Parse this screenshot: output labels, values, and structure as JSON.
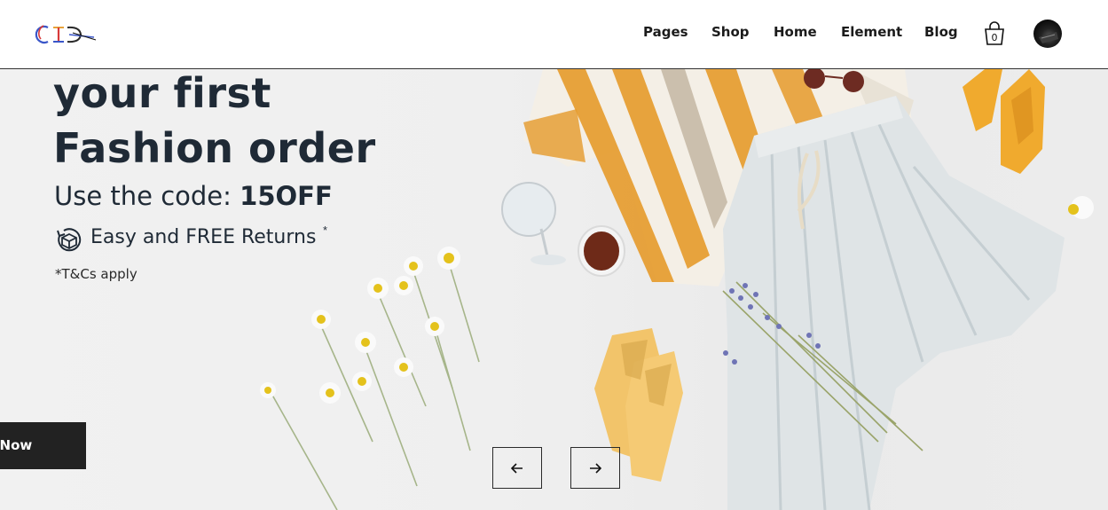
{
  "header": {
    "logo_text": "CIG",
    "nav": [
      {
        "label": "Pages"
      },
      {
        "label": "Shop"
      },
      {
        "label": "Home"
      },
      {
        "label": "Element"
      },
      {
        "label": "Blog"
      }
    ],
    "cart_count": "0",
    "cart_icon": "shopping-bag-icon",
    "avatar_icon": "user-avatar"
  },
  "hero": {
    "headline_line1": "your first",
    "headline_line2": "Fashion order",
    "code_prefix": "Use the code: ",
    "code_value": "15OFF",
    "returns_text": "Easy and FREE Returns",
    "returns_mark": "*",
    "returns_icon": "returns-box-icon",
    "terms": "*T&Cs apply",
    "cta_label": "Shop Now",
    "cta_visible_label": "o Now",
    "prev_icon": "arrow-left-icon",
    "next_icon": "arrow-right-icon"
  },
  "colors": {
    "text_dark": "#1f2a36",
    "button_bg": "#222222",
    "stripe_orange": "#e59a2a",
    "shoe_yellow": "#f0b43a"
  }
}
